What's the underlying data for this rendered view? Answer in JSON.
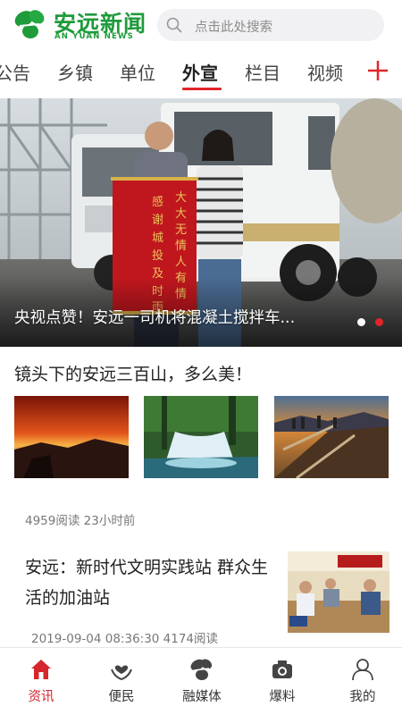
{
  "app": {
    "logo_cn": "安远新闻",
    "logo_en": "AN YUAN NEWS",
    "brand_color": "#1e9b3a",
    "accent_color": "#e0262b"
  },
  "search": {
    "placeholder": "点击此处搜索",
    "icon": "search-icon"
  },
  "tabs": [
    {
      "label": "公告",
      "active": false
    },
    {
      "label": "乡镇",
      "active": false
    },
    {
      "label": "单位",
      "active": false
    },
    {
      "label": "外宣",
      "active": true
    },
    {
      "label": "栏目",
      "active": false
    },
    {
      "label": "视频",
      "active": false
    }
  ],
  "tab_add_icon": "plus-icon",
  "hero": {
    "caption": "央视点赞！安远一司机将混凝土搅拌车...",
    "banner_text": "大大无情人有情 感谢城投及时雨",
    "slide_count": 2,
    "active_slide": 2
  },
  "articles": [
    {
      "title": "镜头下的安远三百山，多么美！",
      "meta": "4959阅读 23小时前"
    },
    {
      "title": "安远：新时代文明实践站 群众生活的加油站",
      "meta": "2019-09-04 08:36:30 4174阅读"
    }
  ],
  "bottom_nav": [
    {
      "label": "资讯",
      "icon": "home-icon",
      "active": true
    },
    {
      "label": "便民",
      "icon": "heart-hands-icon",
      "active": false
    },
    {
      "label": "融媒体",
      "icon": "petal-logo-icon",
      "active": false
    },
    {
      "label": "爆料",
      "icon": "camera-icon",
      "active": false
    },
    {
      "label": "我的",
      "icon": "user-icon",
      "active": false
    }
  ]
}
